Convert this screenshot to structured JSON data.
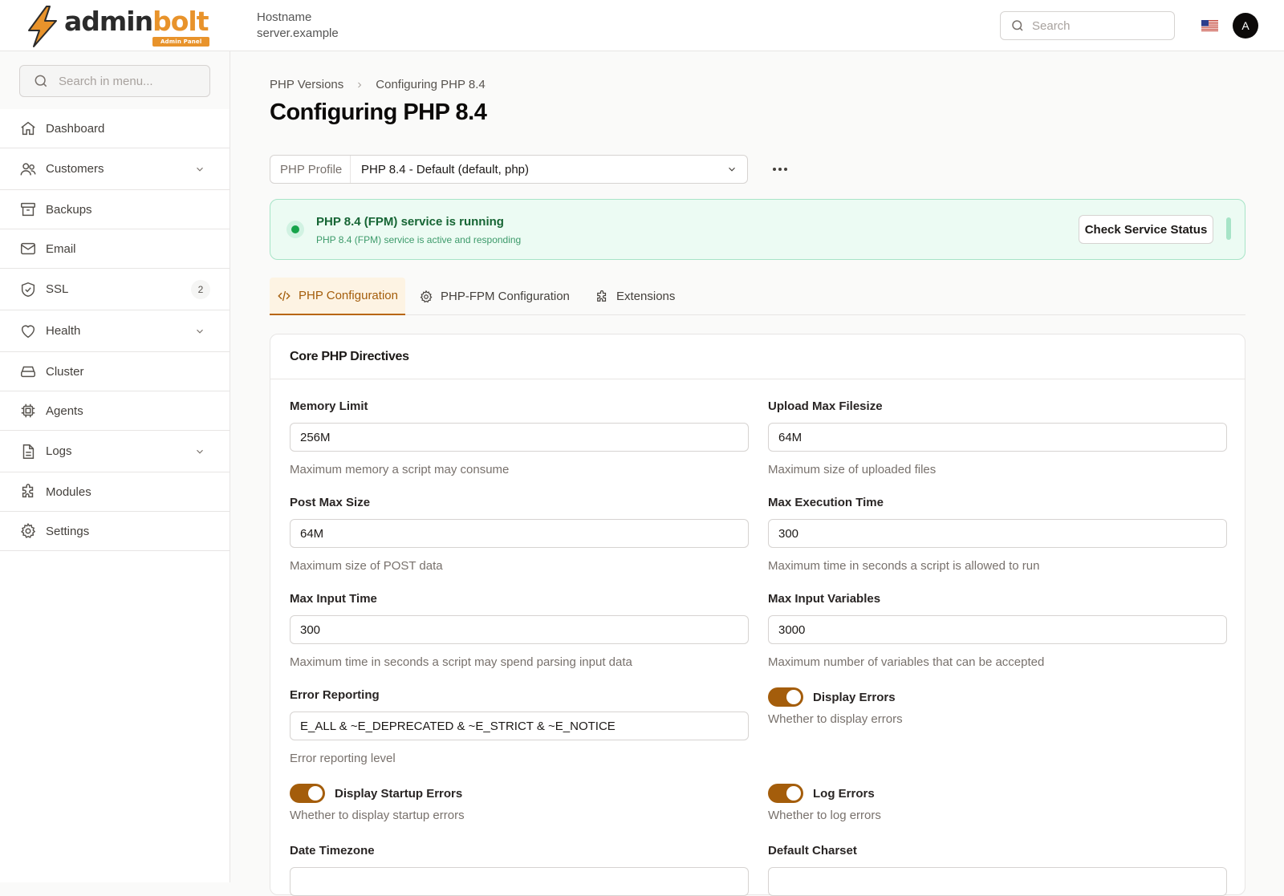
{
  "header": {
    "logo": {
      "part1": "admin",
      "part2": "bolt",
      "badge": "Admin Panel"
    },
    "hostname_label": "Hostname",
    "hostname_value": "server.example",
    "search_placeholder": "Search",
    "avatar_initial": "A"
  },
  "sidebar": {
    "search_placeholder": "Search in menu...",
    "items": [
      {
        "label": "Dashboard",
        "icon": "home-icon"
      },
      {
        "label": "Customers",
        "icon": "users-icon",
        "expandable": true
      },
      {
        "label": "Backups",
        "icon": "archive-icon"
      },
      {
        "label": "Email",
        "icon": "mail-icon"
      },
      {
        "label": "SSL",
        "icon": "shield-check-icon",
        "badge": "2"
      },
      {
        "label": "Health",
        "icon": "heart-icon",
        "expandable": true
      },
      {
        "label": "Cluster",
        "icon": "server-stack-icon"
      },
      {
        "label": "Agents",
        "icon": "cpu-chip-icon"
      },
      {
        "label": "Logs",
        "icon": "document-icon",
        "expandable": true
      },
      {
        "label": "Modules",
        "icon": "puzzle-icon"
      },
      {
        "label": "Settings",
        "icon": "gear-icon"
      }
    ]
  },
  "main": {
    "breadcrumb": [
      "PHP Versions",
      "Configuring PHP 8.4"
    ],
    "title": "Configuring PHP 8.4",
    "profile": {
      "label": "PHP Profile",
      "value": "PHP 8.4 - Default (default, php)"
    },
    "status": {
      "title": "PHP 8.4 (FPM) service is running",
      "subtitle": "PHP 8.4 (FPM) service is active and responding",
      "button": "Check Service Status"
    },
    "tabs": [
      {
        "label": "PHP Configuration",
        "icon": "code-icon",
        "active": true
      },
      {
        "label": "PHP-FPM Configuration",
        "icon": "gear-icon"
      },
      {
        "label": "Extensions",
        "icon": "puzzle-icon"
      }
    ],
    "panel": {
      "title": "Core PHP Directives",
      "fields": {
        "memory_limit": {
          "label": "Memory Limit",
          "value": "256M",
          "help": "Maximum memory a script may consume"
        },
        "upload_max_filesize": {
          "label": "Upload Max Filesize",
          "value": "64M",
          "help": "Maximum size of uploaded files"
        },
        "post_max_size": {
          "label": "Post Max Size",
          "value": "64M",
          "help": "Maximum size of POST data"
        },
        "max_execution_time": {
          "label": "Max Execution Time",
          "value": "300",
          "help": "Maximum time in seconds a script is allowed to run"
        },
        "max_input_time": {
          "label": "Max Input Time",
          "value": "300",
          "help": "Maximum time in seconds a script may spend parsing input data"
        },
        "max_input_vars": {
          "label": "Max Input Variables",
          "value": "3000",
          "help": "Maximum number of variables that can be accepted"
        },
        "error_reporting": {
          "label": "Error Reporting",
          "value": "E_ALL & ~E_DEPRECATED & ~E_STRICT & ~E_NOTICE",
          "help": "Error reporting level"
        },
        "date_timezone": {
          "label": "Date Timezone"
        },
        "default_charset": {
          "label": "Default Charset"
        }
      },
      "toggles": {
        "display_errors": {
          "label": "Display Errors",
          "help": "Whether to display errors",
          "on": true
        },
        "display_startup_errors": {
          "label": "Display Startup Errors",
          "help": "Whether to display startup errors",
          "on": true
        },
        "log_errors": {
          "label": "Log Errors",
          "help": "Whether to log errors",
          "on": true
        }
      }
    }
  },
  "colors": {
    "brand_orange": "#e8932b",
    "accent_brown": "#a45d0b",
    "success_green": "#16a34a",
    "success_bg": "#ecfbf3"
  }
}
